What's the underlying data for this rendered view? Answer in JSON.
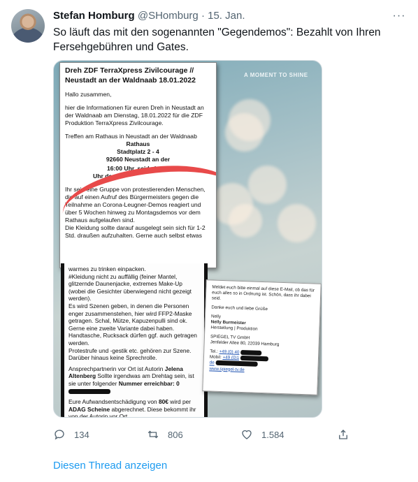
{
  "tweet": {
    "author_name": "Stefan Homburg",
    "handle": "@SHomburg",
    "separator": "·",
    "date": "15. Jan.",
    "more_label": "···",
    "text": "So läuft das mit den sogenannten \"Gegendemos\": Bezahlt von Ihren Fersehgebühren und Gates."
  },
  "media": {
    "watermark": "A MOMENT TO SHINE",
    "doc_top": {
      "title_line1": "Dreh ZDF TerraXpress Zivilcourage //",
      "title_line2": "Neustadt an der Waldnaab 18.01.2022",
      "greeting": "Hallo zusammen,",
      "para1": "hier die Informationen für euren Dreh in Neustadt an der Waldnaab am Dienstag, 18.01.2022 für die ZDF Produktion TerraXpress Zivilcourage.",
      "para2": "Treffen am Rathaus in Neustadt an der Waldnaab",
      "address1": "Rathaus",
      "address2": "Stadtplatz 2 - 4",
      "address3": "92660 Neustadt an der",
      "time_line": "16:00 Uhr, seid also bitte",
      "time_line2": "Uhr da.",
      "para3": "Ihr seid eine Gruppe von protestierenden Menschen, die auf einen Aufruf des Bürgermeisters gegen die Teilnahme an Corona-Leugner-Demos reagiert und über 5 Wochen hinweg zu Montagsdemos vor dem Rathaus aufgelaufen sind.",
      "para4": "Die Kleidung sollte darauf ausgelegt sein sich für 1-2 Std. draußen aufzuhalten. Gerne auch selbst etwas"
    },
    "doc_bottom": {
      "line1": "warmes zu trinken einpacken.",
      "para1": "#Kleidung nicht zu auffällig (feiner Mantel, glitzernde Daunenjacke, extremes Make-Up (wobei die Gesichter überwiegend nicht gezeigt werden).",
      "para2": "Es wird Szenen geben, in denen die Personen enger zusammenstehen, hier wird FFP2-Maske getragen. Schal, Mütze, Kapuzenpulli sind ok. Gerne eine zweite Variante dabei haben. Handtasche, Rucksack dürfen ggf. auch getragen werden.",
      "para3": "Protestrufe und -gestik etc. gehören zur Szene. Darüber hinaus keine Sprechrolle.",
      "contact_prefix": "Ansprechpartnerin vor Ort ist Autorin",
      "contact_name": "Jelena Altenberg",
      "contact_rest": "Sollte irgendwas am Drehtag sein, ist sie unter folgender",
      "contact_number": "Nummer erreichbar: 0",
      "fee_prefix": "Eure Aufwandsentschädigung von",
      "fee_amount": "80€",
      "fee_mid": "wird per",
      "fee_company": "ADAG Scheine",
      "fee_rest": "abgerechnet. Diese bekommt ihr von der Autorin vor Ort."
    },
    "card": {
      "line1": "Meldet euch bitte einmal auf diese E-Mail, ob das für euch alles so in Ordnung ist. Schön, dass ihr dabei seid.",
      "line2": "Danke euch und liebe Grüße",
      "sign1": "Nelly",
      "sign2": "Nelly Burmeister",
      "sign3": "Herstellung | Produktion",
      "company": "SPIEGEL TV GmbH",
      "address": "Jenfelder Allee 80, 22039 Hamburg",
      "tel_label": "Tel.:",
      "tel": "+49 (0) 40",
      "mobil_label": "Mobil:",
      "mobil": "+49 (0)1",
      "email": "de",
      "web": "www.spiegel-tv.de"
    }
  },
  "actions": {
    "reply_count": "134",
    "retweet_count": "806",
    "like_count": "1.584"
  },
  "thread_link": "Diesen Thread anzeigen",
  "colors": {
    "link": "#1d9bf0",
    "muted": "#536471",
    "highlight": "#e84a4a"
  }
}
